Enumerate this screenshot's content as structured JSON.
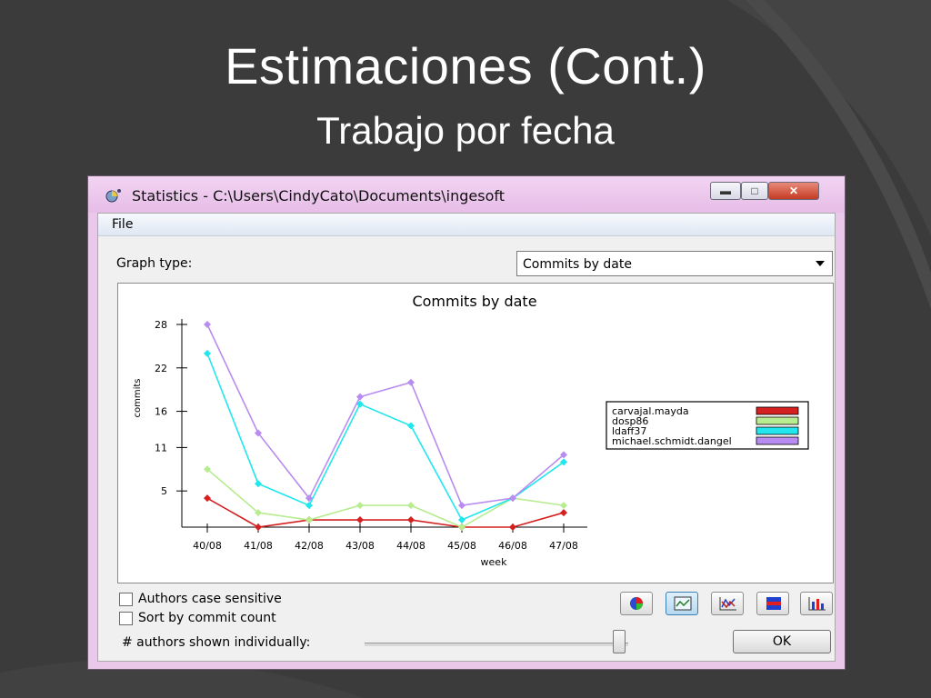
{
  "slide": {
    "title": "Estimaciones (Cont.)",
    "subtitle": "Trabajo por fecha"
  },
  "window": {
    "title": "Statistics - C:\\Users\\CindyCato\\Documents\\ingesoft",
    "app_icon": "statistics-app-icon",
    "controls": [
      "minimize-icon",
      "maximize-icon",
      "close-icon"
    ]
  },
  "menu": {
    "file": "File"
  },
  "graph_type": {
    "label": "Graph type:",
    "selected": "Commits by date"
  },
  "options": {
    "authors_case_sensitive": {
      "label": "Authors case sensitive",
      "checked": false
    },
    "sort_by_commit_count": {
      "label": "Sort by commit count",
      "checked": false
    },
    "authors_shown_label": "# authors shown individually:",
    "authors_shown_level": 1.0
  },
  "toolbar_icons": [
    "pie-chart-icon",
    "line-chart-icon",
    "stacked-line-icon",
    "stacked-bar-icon",
    "bar-chart-icon"
  ],
  "ok_label": "OK",
  "colors": {
    "window_frame": "#e9c8e9",
    "slide_bg": "#3b3b3b"
  },
  "chart_data": {
    "type": "line",
    "title": "Commits by date",
    "xlabel": "week",
    "ylabel": "commits",
    "categories": [
      "40/08",
      "41/08",
      "42/08",
      "43/08",
      "44/08",
      "45/08",
      "46/08",
      "47/08"
    ],
    "yticks": [
      "5",
      "11",
      "16",
      "22",
      "28"
    ],
    "ytick_values": [
      5,
      11,
      16,
      22,
      28
    ],
    "ylim": [
      0,
      28
    ],
    "legend_position": "right",
    "grid": false,
    "series": [
      {
        "name": "carvajal.mayda",
        "color": "#d42020",
        "values": [
          4,
          0,
          1,
          1,
          1,
          0,
          0,
          2
        ]
      },
      {
        "name": "dosp86",
        "color": "#b8ec90",
        "values": [
          8,
          2,
          1,
          3,
          3,
          0,
          4,
          3
        ]
      },
      {
        "name": "ldaff37",
        "color": "#22e6ee",
        "values": [
          24,
          6,
          3,
          17,
          14,
          1,
          4,
          9
        ]
      },
      {
        "name": "michael.schmidt.dangel",
        "color": "#b88cf0",
        "values": [
          28,
          13,
          4,
          18,
          20,
          3,
          4,
          10
        ]
      }
    ]
  }
}
